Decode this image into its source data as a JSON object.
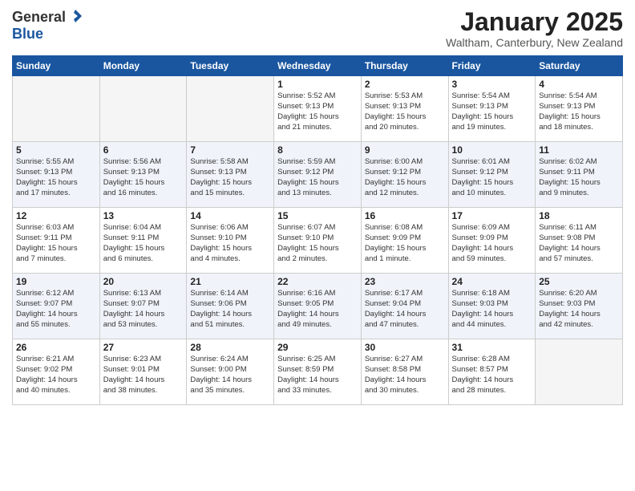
{
  "header": {
    "logo_general": "General",
    "logo_blue": "Blue",
    "month_title": "January 2025",
    "location": "Waltham, Canterbury, New Zealand"
  },
  "days_of_week": [
    "Sunday",
    "Monday",
    "Tuesday",
    "Wednesday",
    "Thursday",
    "Friday",
    "Saturday"
  ],
  "weeks": [
    [
      {
        "day": "",
        "content": ""
      },
      {
        "day": "",
        "content": ""
      },
      {
        "day": "",
        "content": ""
      },
      {
        "day": "1",
        "content": "Sunrise: 5:52 AM\nSunset: 9:13 PM\nDaylight: 15 hours\nand 21 minutes."
      },
      {
        "day": "2",
        "content": "Sunrise: 5:53 AM\nSunset: 9:13 PM\nDaylight: 15 hours\nand 20 minutes."
      },
      {
        "day": "3",
        "content": "Sunrise: 5:54 AM\nSunset: 9:13 PM\nDaylight: 15 hours\nand 19 minutes."
      },
      {
        "day": "4",
        "content": "Sunrise: 5:54 AM\nSunset: 9:13 PM\nDaylight: 15 hours\nand 18 minutes."
      }
    ],
    [
      {
        "day": "5",
        "content": "Sunrise: 5:55 AM\nSunset: 9:13 PM\nDaylight: 15 hours\nand 17 minutes."
      },
      {
        "day": "6",
        "content": "Sunrise: 5:56 AM\nSunset: 9:13 PM\nDaylight: 15 hours\nand 16 minutes."
      },
      {
        "day": "7",
        "content": "Sunrise: 5:58 AM\nSunset: 9:13 PM\nDaylight: 15 hours\nand 15 minutes."
      },
      {
        "day": "8",
        "content": "Sunrise: 5:59 AM\nSunset: 9:12 PM\nDaylight: 15 hours\nand 13 minutes."
      },
      {
        "day": "9",
        "content": "Sunrise: 6:00 AM\nSunset: 9:12 PM\nDaylight: 15 hours\nand 12 minutes."
      },
      {
        "day": "10",
        "content": "Sunrise: 6:01 AM\nSunset: 9:12 PM\nDaylight: 15 hours\nand 10 minutes."
      },
      {
        "day": "11",
        "content": "Sunrise: 6:02 AM\nSunset: 9:11 PM\nDaylight: 15 hours\nand 9 minutes."
      }
    ],
    [
      {
        "day": "12",
        "content": "Sunrise: 6:03 AM\nSunset: 9:11 PM\nDaylight: 15 hours\nand 7 minutes."
      },
      {
        "day": "13",
        "content": "Sunrise: 6:04 AM\nSunset: 9:11 PM\nDaylight: 15 hours\nand 6 minutes."
      },
      {
        "day": "14",
        "content": "Sunrise: 6:06 AM\nSunset: 9:10 PM\nDaylight: 15 hours\nand 4 minutes."
      },
      {
        "day": "15",
        "content": "Sunrise: 6:07 AM\nSunset: 9:10 PM\nDaylight: 15 hours\nand 2 minutes."
      },
      {
        "day": "16",
        "content": "Sunrise: 6:08 AM\nSunset: 9:09 PM\nDaylight: 15 hours\nand 1 minute."
      },
      {
        "day": "17",
        "content": "Sunrise: 6:09 AM\nSunset: 9:09 PM\nDaylight: 14 hours\nand 59 minutes."
      },
      {
        "day": "18",
        "content": "Sunrise: 6:11 AM\nSunset: 9:08 PM\nDaylight: 14 hours\nand 57 minutes."
      }
    ],
    [
      {
        "day": "19",
        "content": "Sunrise: 6:12 AM\nSunset: 9:07 PM\nDaylight: 14 hours\nand 55 minutes."
      },
      {
        "day": "20",
        "content": "Sunrise: 6:13 AM\nSunset: 9:07 PM\nDaylight: 14 hours\nand 53 minutes."
      },
      {
        "day": "21",
        "content": "Sunrise: 6:14 AM\nSunset: 9:06 PM\nDaylight: 14 hours\nand 51 minutes."
      },
      {
        "day": "22",
        "content": "Sunrise: 6:16 AM\nSunset: 9:05 PM\nDaylight: 14 hours\nand 49 minutes."
      },
      {
        "day": "23",
        "content": "Sunrise: 6:17 AM\nSunset: 9:04 PM\nDaylight: 14 hours\nand 47 minutes."
      },
      {
        "day": "24",
        "content": "Sunrise: 6:18 AM\nSunset: 9:03 PM\nDaylight: 14 hours\nand 44 minutes."
      },
      {
        "day": "25",
        "content": "Sunrise: 6:20 AM\nSunset: 9:03 PM\nDaylight: 14 hours\nand 42 minutes."
      }
    ],
    [
      {
        "day": "26",
        "content": "Sunrise: 6:21 AM\nSunset: 9:02 PM\nDaylight: 14 hours\nand 40 minutes."
      },
      {
        "day": "27",
        "content": "Sunrise: 6:23 AM\nSunset: 9:01 PM\nDaylight: 14 hours\nand 38 minutes."
      },
      {
        "day": "28",
        "content": "Sunrise: 6:24 AM\nSunset: 9:00 PM\nDaylight: 14 hours\nand 35 minutes."
      },
      {
        "day": "29",
        "content": "Sunrise: 6:25 AM\nSunset: 8:59 PM\nDaylight: 14 hours\nand 33 minutes."
      },
      {
        "day": "30",
        "content": "Sunrise: 6:27 AM\nSunset: 8:58 PM\nDaylight: 14 hours\nand 30 minutes."
      },
      {
        "day": "31",
        "content": "Sunrise: 6:28 AM\nSunset: 8:57 PM\nDaylight: 14 hours\nand 28 minutes."
      },
      {
        "day": "",
        "content": ""
      }
    ]
  ]
}
